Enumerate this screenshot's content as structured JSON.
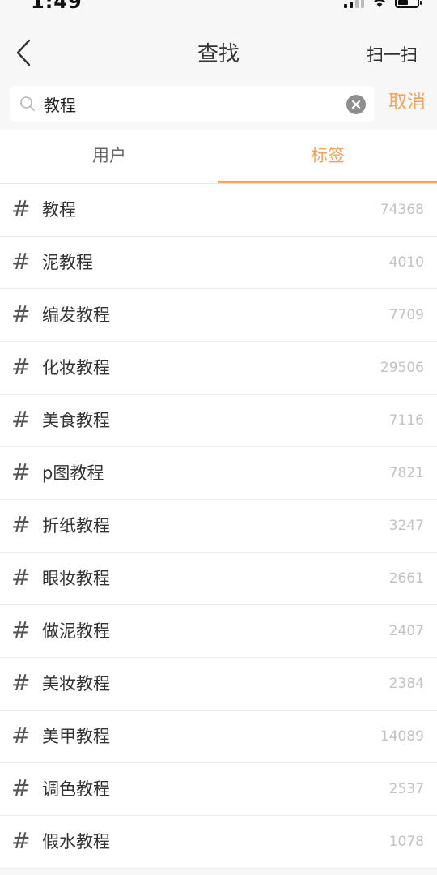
{
  "status": {
    "time": "1:49"
  },
  "nav": {
    "title": "查找",
    "scan_label": "扫一扫"
  },
  "search": {
    "value": "教程",
    "placeholder": "",
    "cancel_label": "取消"
  },
  "tabs": [
    {
      "label": "用户",
      "active": false
    },
    {
      "label": "标签",
      "active": true
    }
  ],
  "colors": {
    "accent": "#f0a45e",
    "count": "#c2c2c2"
  },
  "hash_symbol": "#",
  "tags": [
    {
      "name": "教程",
      "count": "74368"
    },
    {
      "name": "泥教程",
      "count": "4010"
    },
    {
      "name": "编发教程",
      "count": "7709"
    },
    {
      "name": "化妆教程",
      "count": "29506"
    },
    {
      "name": "美食教程",
      "count": "7116"
    },
    {
      "name": "p图教程",
      "count": "7821"
    },
    {
      "name": "折纸教程",
      "count": "3247"
    },
    {
      "name": "眼妆教程",
      "count": "2661"
    },
    {
      "name": "做泥教程",
      "count": "2407"
    },
    {
      "name": "美妆教程",
      "count": "2384"
    },
    {
      "name": "美甲教程",
      "count": "14089"
    },
    {
      "name": "调色教程",
      "count": "2537"
    },
    {
      "name": "假水教程",
      "count": "1078"
    }
  ]
}
